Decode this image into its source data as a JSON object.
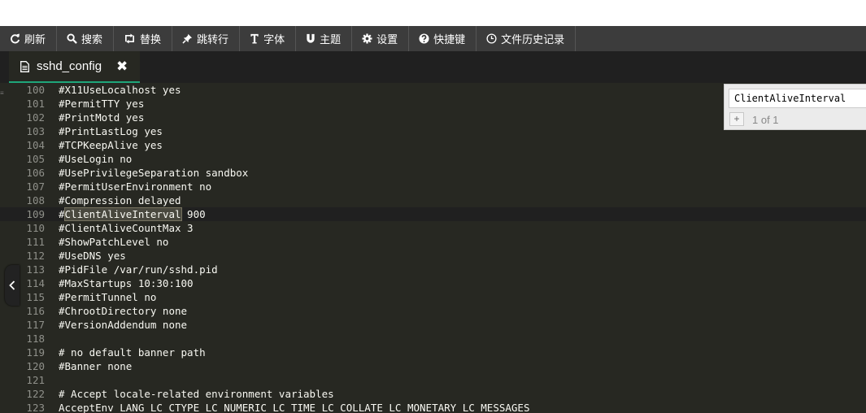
{
  "toolbar": {
    "items": [
      {
        "label": "刷新",
        "icon": "refresh-icon"
      },
      {
        "label": "搜索",
        "icon": "search-icon"
      },
      {
        "label": "替换",
        "icon": "replace-icon"
      },
      {
        "label": "跳转行",
        "icon": "pin-icon"
      },
      {
        "label": "字体",
        "icon": "font-icon"
      },
      {
        "label": "主题",
        "icon": "magnet-icon"
      },
      {
        "label": "设置",
        "icon": "gear-icon"
      },
      {
        "label": "快捷键",
        "icon": "help-icon"
      },
      {
        "label": "文件历史记录",
        "icon": "clock-icon"
      }
    ]
  },
  "tab": {
    "title": "sshd_config",
    "close_symbol": "✖",
    "icon": "file-icon"
  },
  "editor": {
    "active_line": 109,
    "lines": [
      {
        "n": "100",
        "text": "#X11UseLocalhost yes"
      },
      {
        "n": "101",
        "text": "#PermitTTY yes"
      },
      {
        "n": "102",
        "text": "#PrintMotd yes"
      },
      {
        "n": "103",
        "text": "#PrintLastLog yes"
      },
      {
        "n": "104",
        "text": "#TCPKeepAlive yes"
      },
      {
        "n": "105",
        "text": "#UseLogin no"
      },
      {
        "n": "106",
        "text": "#UsePrivilegeSeparation sandbox"
      },
      {
        "n": "107",
        "text": "#PermitUserEnvironment no"
      },
      {
        "n": "108",
        "text": "#Compression delayed"
      },
      {
        "n": "109",
        "text": "#ClientAliveInterval 900",
        "highlight": "ClientAliveInterval"
      },
      {
        "n": "110",
        "text": "#ClientAliveCountMax 3"
      },
      {
        "n": "111",
        "text": "#ShowPatchLevel no"
      },
      {
        "n": "112",
        "text": "#UseDNS yes"
      },
      {
        "n": "113",
        "text": "#PidFile /var/run/sshd.pid"
      },
      {
        "n": "114",
        "text": "#MaxStartups 10:30:100"
      },
      {
        "n": "115",
        "text": "#PermitTunnel no"
      },
      {
        "n": "116",
        "text": "#ChrootDirectory none"
      },
      {
        "n": "117",
        "text": "#VersionAddendum none"
      },
      {
        "n": "118",
        "text": ""
      },
      {
        "n": "119",
        "text": "# no default banner path"
      },
      {
        "n": "120",
        "text": "#Banner none"
      },
      {
        "n": "121",
        "text": ""
      },
      {
        "n": "122",
        "text": "# Accept locale-related environment variables"
      },
      {
        "n": "123",
        "text": "AcceptEnv LANG LC_CTYPE LC_NUMERIC LC_TIME LC_COLLATE LC_MONETARY LC_MESSAGES"
      }
    ]
  },
  "search": {
    "query": "ClientAliveInterval",
    "plus": "+",
    "count": "1 of 1"
  },
  "colors": {
    "toolbar_bg": "#3c3c3c",
    "editor_bg": "#272822",
    "tab_accent": "#1fa67a",
    "gutter_text": "#8f908a",
    "code_text": "#f8f8f2"
  }
}
